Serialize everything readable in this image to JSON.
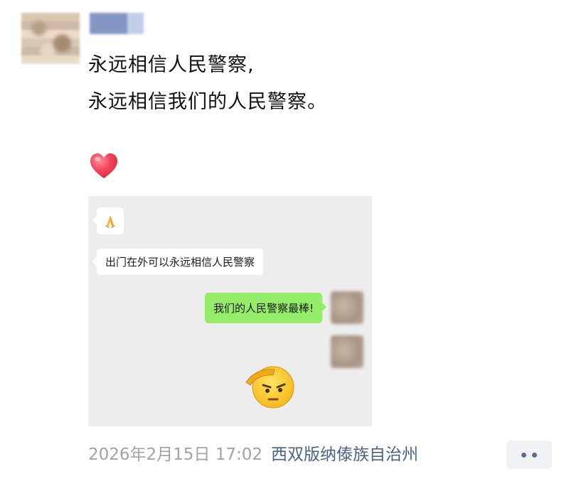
{
  "post": {
    "lines": [
      "永远相信人民警察,",
      "永远相信我们的人民警察。"
    ],
    "reaction_icon": "heart-icon",
    "heart_color": "#f0445a"
  },
  "screenshot": {
    "messages": [
      {
        "side": "left",
        "icon": "pray-icon",
        "text": ""
      },
      {
        "side": "left",
        "text": "出门在外可以永远相信人民警察"
      },
      {
        "side": "right",
        "text": "我们的人民警察最棒!"
      }
    ],
    "sticker": "salute-emoji-icon",
    "bubble_color": "#95ec69"
  },
  "footer": {
    "timestamp": "2026年2月15日 17:02",
    "location": "西双版纳傣族自治州"
  },
  "colors": {
    "link": "#4c6188",
    "muted": "#a3a3a3"
  }
}
